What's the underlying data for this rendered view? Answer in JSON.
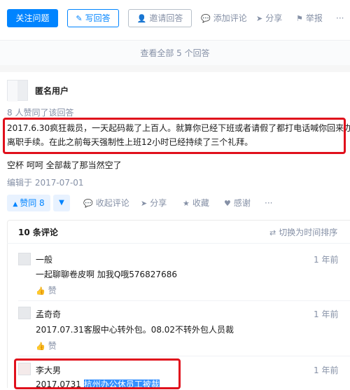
{
  "top_bar": {
    "follow_label": "关注问题",
    "write_answer_label": "写回答",
    "invite_label": "邀请回答",
    "comment_label": "添加评论",
    "share_label": "分享",
    "report_label": "举报",
    "more_label": "···"
  },
  "view_all_label": "查看全部 5 个回答",
  "answer": {
    "author": "匿名用户",
    "vote_info": "8 人赞同了该回答",
    "text_line1": "2017.6.30疯狂裁员，一天起码裁了上百人。就算你已经下班或者请假了都打电话喊你回来办",
    "text_line2": "离职手续。在此之前每天强制性上班12小时已经持续了三个礼拜。",
    "text_extra": "空杯 呵呵 全部裁了那当然空了",
    "edit_date": "编辑于 2017-07-01"
  },
  "actions": {
    "vote_label": "赞同 8",
    "collapse_comments_label": "收起评论",
    "share_label": "分享",
    "collect_label": "收藏",
    "thanks_label": "感谢",
    "more_label": "···"
  },
  "comments": {
    "count_label": "10 条评论",
    "switch_label": "切换为时间排序",
    "items": [
      {
        "name": "一般",
        "time": "1 年前",
        "text": "一起聊聊卷皮啊 加我Q哦576827686",
        "like_label": "赞"
      },
      {
        "name": "孟奇奇",
        "time": "1 年前",
        "text": "2017.07.31客服中心转外包。08.02不转外包人员裁",
        "like_label": "赞"
      },
      {
        "name": "李大男",
        "time": "1 年前",
        "text_plain": "2017.0731 ",
        "text_selected": "杭州办公休员工被裁"
      }
    ]
  },
  "colors": {
    "primary": "#0084ff",
    "muted": "#8590a6",
    "highlight": "#e0101c",
    "selection": "#3390ff"
  }
}
